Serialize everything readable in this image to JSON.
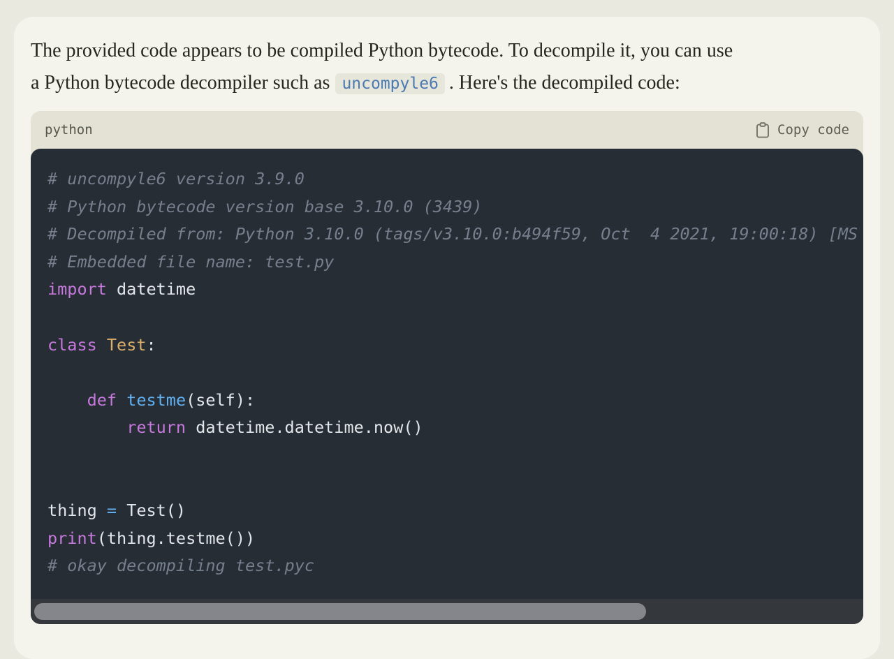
{
  "message": {
    "line1": "The provided code appears to be compiled Python bytecode. To decompile it, you can use",
    "line2_pre": "a Python bytecode decompiler such as",
    "inline_code": "uncompyle6",
    "line2_post": ". Here's the decompiled code:"
  },
  "code_block": {
    "language_label": "python",
    "copy_button_label": "Copy code",
    "copy_icon": "clipboard-icon",
    "scrollbar": {
      "orientation": "horizontal",
      "thumb_fraction": 0.735
    }
  },
  "code": {
    "language": "python",
    "lines": [
      [
        [
          "c",
          "# uncompyle6 version 3.9.0"
        ]
      ],
      [
        [
          "c",
          "# Python bytecode version base 3.10.0 (3439)"
        ]
      ],
      [
        [
          "c",
          "# Decompiled from: Python 3.10.0 (tags/v3.10.0:b494f59, Oct  4 2021, 19:00:18) [MS"
        ]
      ],
      [
        [
          "c",
          "# Embedded file name: test.py"
        ]
      ],
      [
        [
          "k",
          "import"
        ],
        [
          "p",
          " datetime"
        ]
      ],
      [
        [
          "p",
          ""
        ]
      ],
      [
        [
          "k",
          "class"
        ],
        [
          "p",
          " "
        ],
        [
          "cl",
          "Test"
        ],
        [
          "p",
          ":"
        ]
      ],
      [
        [
          "p",
          ""
        ]
      ],
      [
        [
          "p",
          "    "
        ],
        [
          "k",
          "def"
        ],
        [
          "p",
          " "
        ],
        [
          "f",
          "testme"
        ],
        [
          "p",
          "(self):"
        ]
      ],
      [
        [
          "p",
          "        "
        ],
        [
          "k",
          "return"
        ],
        [
          "p",
          " datetime.datetime.now()"
        ]
      ],
      [
        [
          "p",
          ""
        ]
      ],
      [
        [
          "p",
          ""
        ]
      ],
      [
        [
          "p",
          "thing "
        ],
        [
          "o",
          "="
        ],
        [
          "p",
          " Test()"
        ]
      ],
      [
        [
          "k",
          "print"
        ],
        [
          "p",
          "(thing.testme())"
        ]
      ],
      [
        [
          "c",
          "# okay decompiling test.pyc"
        ]
      ]
    ]
  },
  "colors": {
    "page_bg": "#eae9e0",
    "card_bg": "#f4f3ec",
    "code_header_bg": "#e3e2d5",
    "code_bg": "#262d34",
    "comment": "#767f8d",
    "keyword": "#c678dd",
    "class_name": "#ddb06a",
    "function": "#61afef",
    "operator": "#61afef",
    "plain_code": "#e3e6ea",
    "inline_code_text": "#4a7ab0",
    "inline_code_bg": "#e7e6db",
    "body_text": "#26261f",
    "scroll_track": "#34383c",
    "scroll_thumb": "#85868b"
  }
}
